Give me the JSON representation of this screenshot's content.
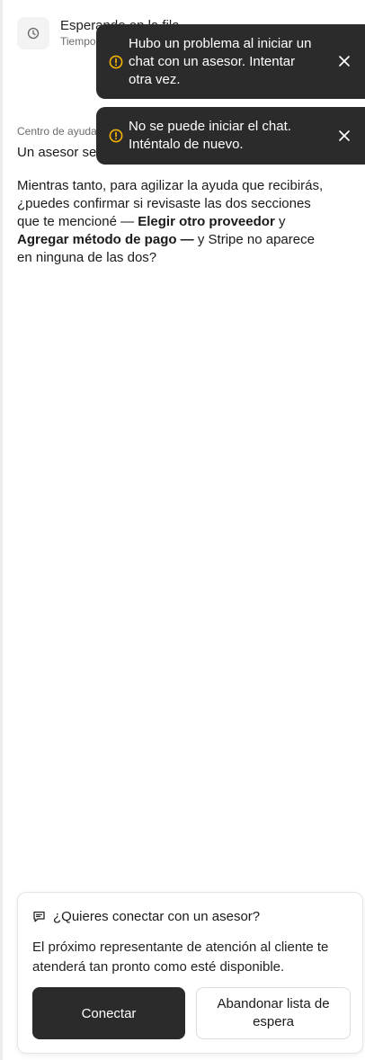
{
  "queue": {
    "title": "Esperando en la fila",
    "subtitle": "Tiempo"
  },
  "message": {
    "source": "Centro de ayuda",
    "first_line": "Un asesor se",
    "para_intro": "Mientras tanto, para agilizar la ayuda que recibirás, ¿puedes confirmar si revisaste las dos secciones que te mencioné — ",
    "section_1": "Elegir otro proveedor",
    "joiner": " y ",
    "section_2": "Agregar método de pago —",
    "para_end": " y Stripe no aparece en ninguna de las dos?"
  },
  "toasts": [
    {
      "text": "Hubo un problema al iniciar un chat con un asesor. Intentar otra vez.",
      "icon": "warning-icon"
    },
    {
      "text": "No se puede iniciar el chat. Inténtalo de nuevo.",
      "icon": "warning-icon"
    }
  ],
  "connect_card": {
    "title": "¿Quieres conectar con un asesor?",
    "body": "El próximo representante de atención al cliente te atenderá tan pronto como esté disponible.",
    "connect_label": "Conectar",
    "leave_label": "Abandonar lista de espera"
  },
  "colors": {
    "toast_bg": "#2b2b2b",
    "warning": "#f5b400",
    "primary_button": "#2b2b2b"
  }
}
